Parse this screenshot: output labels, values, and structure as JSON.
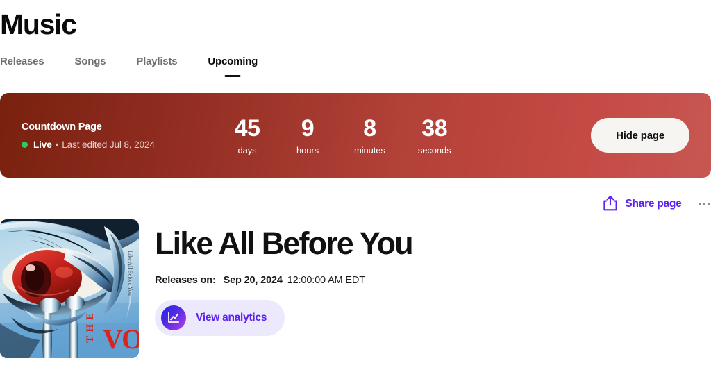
{
  "header": {
    "title": "Music"
  },
  "tabs": [
    {
      "label": "Releases",
      "active": false
    },
    {
      "label": "Songs",
      "active": false
    },
    {
      "label": "Playlists",
      "active": false
    },
    {
      "label": "Upcoming",
      "active": true
    }
  ],
  "banner": {
    "title": "Countdown Page",
    "status_label": "Live",
    "separator": "•",
    "last_edited": "Last edited Jul 8, 2024",
    "status_dot_color": "#2ecb5e",
    "gradient_from": "#79210f",
    "gradient_to": "#c75752",
    "hide_button_label": "Hide page",
    "countdown": [
      {
        "value": "45",
        "unit": "days"
      },
      {
        "value": "9",
        "unit": "hours"
      },
      {
        "value": "8",
        "unit": "minutes"
      },
      {
        "value": "38",
        "unit": "seconds"
      }
    ]
  },
  "actions": {
    "share_label": "Share page",
    "share_icon": "share-upload-icon",
    "more_icon": "ellipsis-icon",
    "accent_color": "#5b21f0"
  },
  "release": {
    "title": "Like All Before You",
    "releases_on_label": "Releases on:",
    "release_date": "Sep 20, 2024",
    "release_time": "12:00:00 AM EDT",
    "analytics_label": "View analytics",
    "analytics_icon": "line-chart-icon",
    "artwork": {
      "alt": "Album artwork: airbrushed crying eye",
      "artist_text": "THE VOIDZ",
      "handwriting_text": "Like All Before You"
    }
  }
}
